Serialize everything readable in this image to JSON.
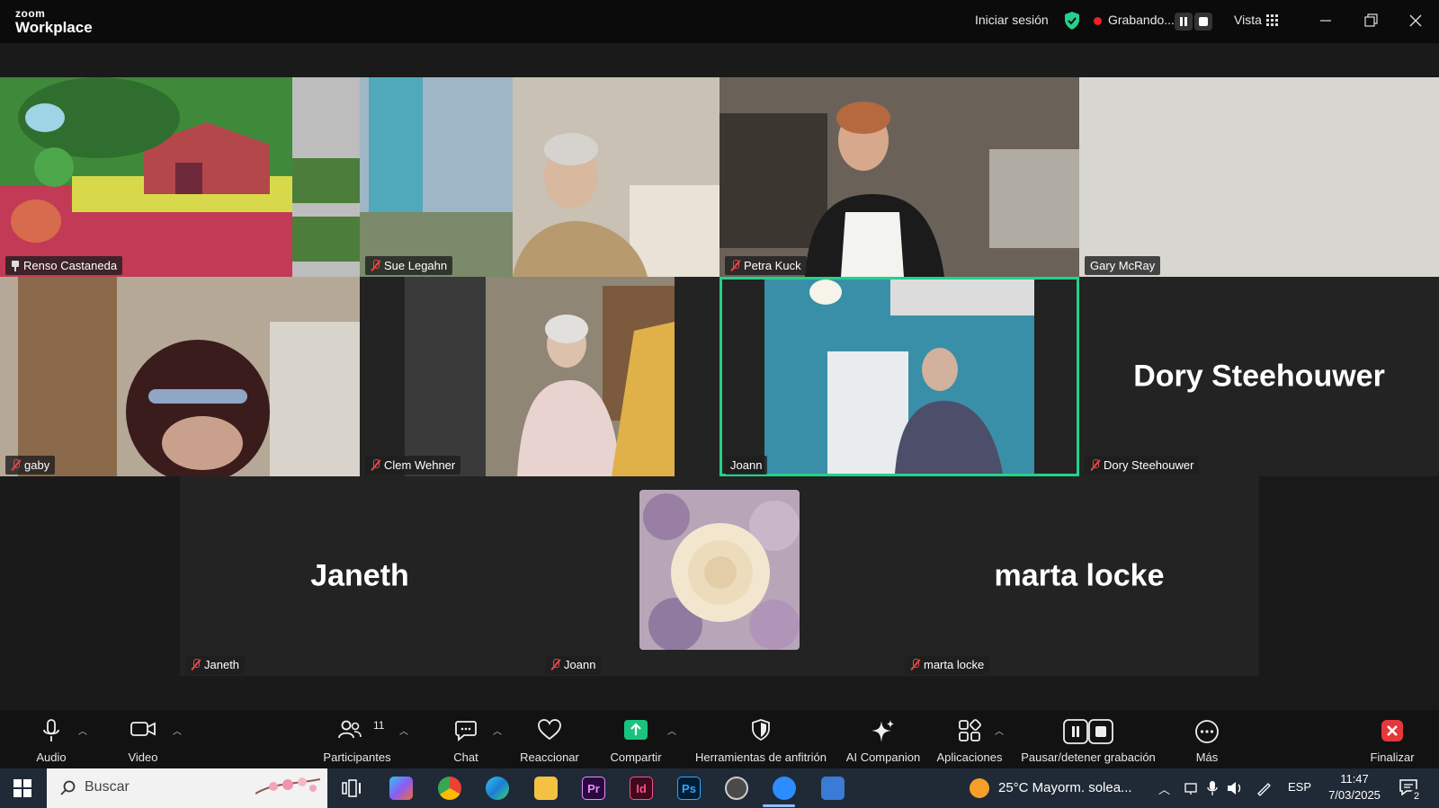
{
  "app": {
    "brand_small": "zoom",
    "brand": "Workplace"
  },
  "titlebar": {
    "signin": "Iniciar sesión",
    "recording": "Grabando...",
    "view": "Vista"
  },
  "tiles": [
    {
      "name": "Renso Castaneda",
      "type": "video",
      "icon": "pin-icon"
    },
    {
      "name": "Sue Legahn",
      "type": "video",
      "icon": "mic-muted-icon"
    },
    {
      "name": "Petra Kuck",
      "type": "video",
      "icon": "mic-muted-icon"
    },
    {
      "name": "Gary McRay",
      "type": "video",
      "icon": ""
    },
    {
      "name": "gaby",
      "type": "video",
      "icon": "mic-muted-icon"
    },
    {
      "name": "Clem Wehner",
      "type": "video",
      "icon": "mic-muted-icon"
    },
    {
      "name": "Joann",
      "type": "video",
      "icon": "",
      "active": true
    },
    {
      "name": "Dory Steehouwer",
      "type": "name",
      "icon": "mic-muted-icon"
    },
    {
      "name": "Janeth",
      "type": "name",
      "icon": "mic-muted-icon"
    },
    {
      "name": "Joann",
      "type": "avatar",
      "icon": "mic-muted-icon"
    },
    {
      "name": "marta locke",
      "type": "name",
      "icon": "mic-muted-icon"
    }
  ],
  "toolbar": {
    "audio": "Audio",
    "video": "Video",
    "participants": "Participantes",
    "participants_count": "11",
    "chat": "Chat",
    "react": "Reaccionar",
    "share": "Compartir",
    "host_tools": "Herramientas de anfitrión",
    "ai": "AI Companion",
    "apps": "Aplicaciones",
    "pause_rec": "Pausar/detener grabación",
    "more": "Más",
    "end": "Finalizar"
  },
  "taskbar": {
    "search": "Buscar",
    "weather": "25°C  Mayorm. solea...",
    "lang": "ESP",
    "time": "11:47",
    "date": "7/03/2025",
    "notif_count": "2",
    "apps": [
      "Pr",
      "Id",
      "Ps"
    ]
  },
  "colors": {
    "accent_green": "#23d18b",
    "record_red": "#ee2222",
    "end_red": "#e5383b",
    "share_green": "#19c37d"
  }
}
